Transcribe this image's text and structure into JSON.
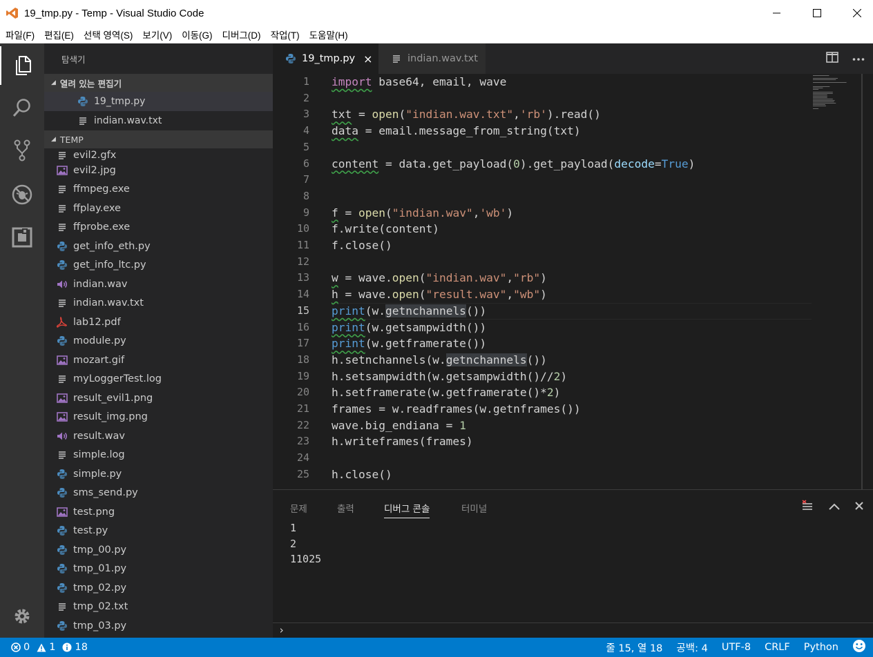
{
  "window": {
    "title": "19_tmp.py - Temp - Visual Studio Code",
    "icon": "vscode-logo-icon"
  },
  "menu": [
    "파일(F)",
    "편집(E)",
    "선택 영역(S)",
    "보기(V)",
    "이동(G)",
    "디버그(D)",
    "작업(T)",
    "도움말(H)"
  ],
  "activity": [
    "files-icon",
    "search-icon",
    "source-control-icon",
    "debug-icon",
    "extensions-icon",
    "settings-gear-icon"
  ],
  "sidebar": {
    "title": "탐색기",
    "open_editors_header": "열려 있는 편집기",
    "open_editors": [
      {
        "name": "19_tmp.py",
        "icon": "python-icon",
        "selected": true
      },
      {
        "name": "indian.wav.txt",
        "icon": "text-file-icon",
        "selected": false
      }
    ],
    "folder_header": "TEMP",
    "files": [
      {
        "name": "evil2.gfx",
        "icon": "text-file-icon"
      },
      {
        "name": "evil2.jpg",
        "icon": "image-icon"
      },
      {
        "name": "ffmpeg.exe",
        "icon": "text-file-icon"
      },
      {
        "name": "ffplay.exe",
        "icon": "text-file-icon"
      },
      {
        "name": "ffprobe.exe",
        "icon": "text-file-icon"
      },
      {
        "name": "get_info_eth.py",
        "icon": "python-icon"
      },
      {
        "name": "get_info_ltc.py",
        "icon": "python-icon"
      },
      {
        "name": "indian.wav",
        "icon": "audio-icon"
      },
      {
        "name": "indian.wav.txt",
        "icon": "text-file-icon"
      },
      {
        "name": "lab12.pdf",
        "icon": "pdf-icon"
      },
      {
        "name": "module.py",
        "icon": "python-icon"
      },
      {
        "name": "mozart.gif",
        "icon": "image-icon"
      },
      {
        "name": "myLoggerTest.log",
        "icon": "text-file-icon"
      },
      {
        "name": "result_evil1.png",
        "icon": "image-icon"
      },
      {
        "name": "result_img.png",
        "icon": "image-icon"
      },
      {
        "name": "result.wav",
        "icon": "audio-icon"
      },
      {
        "name": "simple.log",
        "icon": "text-file-icon"
      },
      {
        "name": "simple.py",
        "icon": "python-icon"
      },
      {
        "name": "sms_send.py",
        "icon": "python-icon"
      },
      {
        "name": "test.png",
        "icon": "image-icon"
      },
      {
        "name": "test.py",
        "icon": "python-icon"
      },
      {
        "name": "tmp_00.py",
        "icon": "python-icon"
      },
      {
        "name": "tmp_01.py",
        "icon": "python-icon"
      },
      {
        "name": "tmp_02.py",
        "icon": "python-icon"
      },
      {
        "name": "tmp_02.txt",
        "icon": "text-file-icon"
      },
      {
        "name": "tmp_03.py",
        "icon": "python-icon"
      }
    ]
  },
  "tabs": [
    {
      "label": "19_tmp.py",
      "icon": "python-icon",
      "close": "×",
      "active": true
    },
    {
      "label": "indian.wav.txt",
      "icon": "text-file-icon",
      "active": false
    }
  ],
  "tab_actions": [
    "split-editor-icon",
    "more-actions-icon"
  ],
  "editor": {
    "current_line": 15,
    "lines": [
      {
        "n": "1",
        "tokens": [
          [
            "kw sq",
            "import"
          ],
          [
            "plain",
            " base64, email, wave"
          ]
        ]
      },
      {
        "n": "2",
        "tokens": []
      },
      {
        "n": "3",
        "tokens": [
          [
            "plain sq",
            "txt"
          ],
          [
            "plain",
            " = "
          ],
          [
            "fn",
            "open"
          ],
          [
            "plain",
            "("
          ],
          [
            "str",
            "\"indian.wav.txt\""
          ],
          [
            "plain",
            ","
          ],
          [
            "str",
            "'rb'"
          ],
          [
            "plain",
            ").read()"
          ]
        ]
      },
      {
        "n": "4",
        "tokens": [
          [
            "plain sq",
            "data"
          ],
          [
            "plain",
            " = email.message_from_string(txt)"
          ]
        ]
      },
      {
        "n": "5",
        "tokens": []
      },
      {
        "n": "6",
        "tokens": [
          [
            "plain sq",
            "content"
          ],
          [
            "plain",
            " = data.get_payload("
          ],
          [
            "num",
            "0"
          ],
          [
            "plain",
            ").get_payload("
          ],
          [
            "param",
            "decode"
          ],
          [
            "plain",
            "="
          ],
          [
            "bi",
            "True"
          ],
          [
            "plain",
            ")"
          ]
        ]
      },
      {
        "n": "7",
        "tokens": []
      },
      {
        "n": "8",
        "tokens": []
      },
      {
        "n": "9",
        "tokens": [
          [
            "plain sq",
            "f"
          ],
          [
            "plain",
            " = "
          ],
          [
            "fn",
            "open"
          ],
          [
            "plain",
            "("
          ],
          [
            "str",
            "\"indian.wav\""
          ],
          [
            "plain",
            ","
          ],
          [
            "str",
            "'wb'"
          ],
          [
            "plain",
            ")"
          ]
        ]
      },
      {
        "n": "10",
        "tokens": [
          [
            "plain",
            "f.write(content)"
          ]
        ]
      },
      {
        "n": "11",
        "tokens": [
          [
            "plain",
            "f.close()"
          ]
        ]
      },
      {
        "n": "12",
        "tokens": []
      },
      {
        "n": "13",
        "tokens": [
          [
            "plain sq",
            "w"
          ],
          [
            "plain",
            " = wave."
          ],
          [
            "fn",
            "open"
          ],
          [
            "plain",
            "("
          ],
          [
            "str",
            "\"indian.wav\""
          ],
          [
            "plain",
            ","
          ],
          [
            "str",
            "\"rb\""
          ],
          [
            "plain",
            ")"
          ]
        ]
      },
      {
        "n": "14",
        "tokens": [
          [
            "plain sq",
            "h"
          ],
          [
            "plain",
            " = wave."
          ],
          [
            "fn",
            "open"
          ],
          [
            "plain",
            "("
          ],
          [
            "str",
            "\"result.wav\""
          ],
          [
            "plain",
            ","
          ],
          [
            "str",
            "\"wb\""
          ],
          [
            "plain",
            ")"
          ]
        ]
      },
      {
        "n": "15",
        "tokens": [
          [
            "bi sq",
            "print"
          ],
          [
            "plain",
            "(w."
          ],
          [
            "plain hl",
            "getnchannels"
          ],
          [
            "plain",
            "())"
          ]
        ]
      },
      {
        "n": "16",
        "tokens": [
          [
            "bi sq",
            "print"
          ],
          [
            "plain",
            "(w.getsampwidth())"
          ]
        ]
      },
      {
        "n": "17",
        "tokens": [
          [
            "bi sq",
            "print"
          ],
          [
            "plain",
            "(w.getframerate())"
          ]
        ]
      },
      {
        "n": "18",
        "tokens": [
          [
            "plain",
            "h.setnchannels(w."
          ],
          [
            "plain hl",
            "getnchannels"
          ],
          [
            "plain",
            "())"
          ]
        ]
      },
      {
        "n": "19",
        "tokens": [
          [
            "plain",
            "h.setsampwidth(w.getsampwidth()//"
          ],
          [
            "num",
            "2"
          ],
          [
            "plain",
            ")"
          ]
        ]
      },
      {
        "n": "20",
        "tokens": [
          [
            "plain",
            "h.setframerate(w.getframerate()*"
          ],
          [
            "num",
            "2"
          ],
          [
            "plain",
            ")"
          ]
        ]
      },
      {
        "n": "21",
        "tokens": [
          [
            "plain",
            "frames = w.readframes(w.getnframes())"
          ]
        ]
      },
      {
        "n": "22",
        "tokens": [
          [
            "plain",
            "wave.big_endiana = "
          ],
          [
            "num",
            "1"
          ]
        ]
      },
      {
        "n": "23",
        "tokens": [
          [
            "plain",
            "h.writeframes(frames)"
          ]
        ]
      },
      {
        "n": "24",
        "tokens": []
      },
      {
        "n": "25",
        "tokens": [
          [
            "plain",
            "h.close()"
          ]
        ]
      }
    ]
  },
  "panel": {
    "tabs": [
      {
        "label": "문제",
        "active": false
      },
      {
        "label": "출력",
        "active": false
      },
      {
        "label": "디버그 콘솔",
        "active": true
      },
      {
        "label": "터미널",
        "active": false
      }
    ],
    "actions": [
      "clear-console-icon",
      "maximize-panel-icon",
      "close-panel-icon"
    ],
    "output": [
      "1",
      "2",
      "11025"
    ],
    "prompt": "›"
  },
  "status": {
    "errors": "0",
    "warnings": "1",
    "infos": "18",
    "position": "줄 15, 열 18",
    "indent": "공백: 4",
    "encoding": "UTF-8",
    "eol": "CRLF",
    "language": "Python",
    "feedback_icon": "smiley-icon"
  },
  "colors": {
    "accent": "#007acc",
    "activity_bar": "#333333",
    "sidebar": "#252526",
    "editor_bg": "#1e1e1e"
  }
}
